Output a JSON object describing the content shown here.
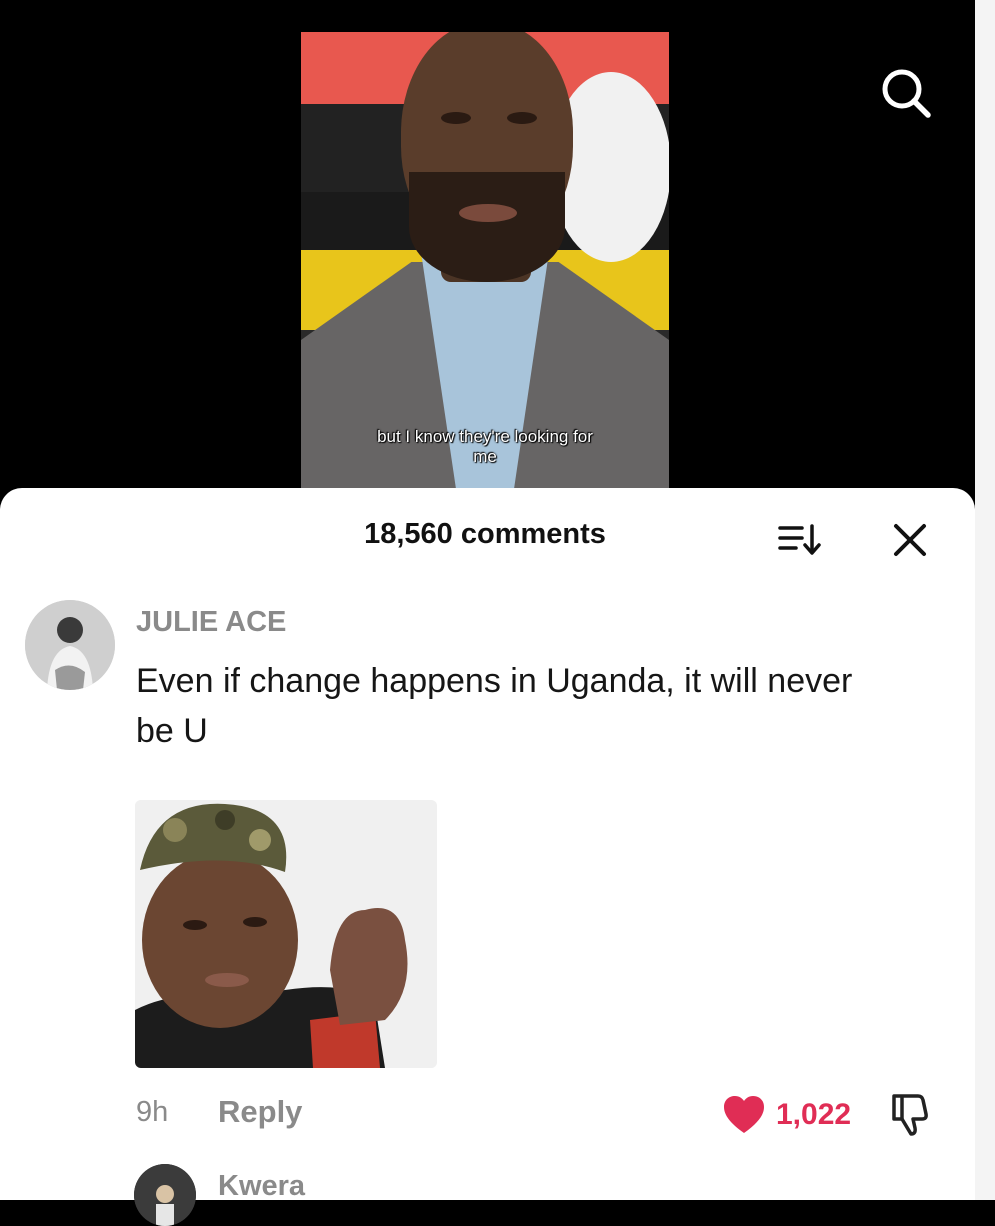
{
  "video": {
    "caption_line1": "but I know they're looking for",
    "caption_line2": "me",
    "search_icon": "search-icon"
  },
  "comments_sheet": {
    "title": "18,560 comments",
    "sort_icon": "sort-icon",
    "close_icon": "close-icon"
  },
  "comment": {
    "username": "JULIE ACE",
    "text": "Even if change happens in Uganda, it will never be U",
    "time": "9h",
    "reply_label": "Reply",
    "like_count": "1,022",
    "like_icon": "heart-icon",
    "dislike_icon": "thumbs-down-icon"
  },
  "next_comment": {
    "username": "Kwera"
  },
  "colors": {
    "like_red": "#e02d55",
    "muted_gray": "#8a8a8a",
    "sheet_bg": "#ffffff",
    "page_bg": "#000000"
  }
}
